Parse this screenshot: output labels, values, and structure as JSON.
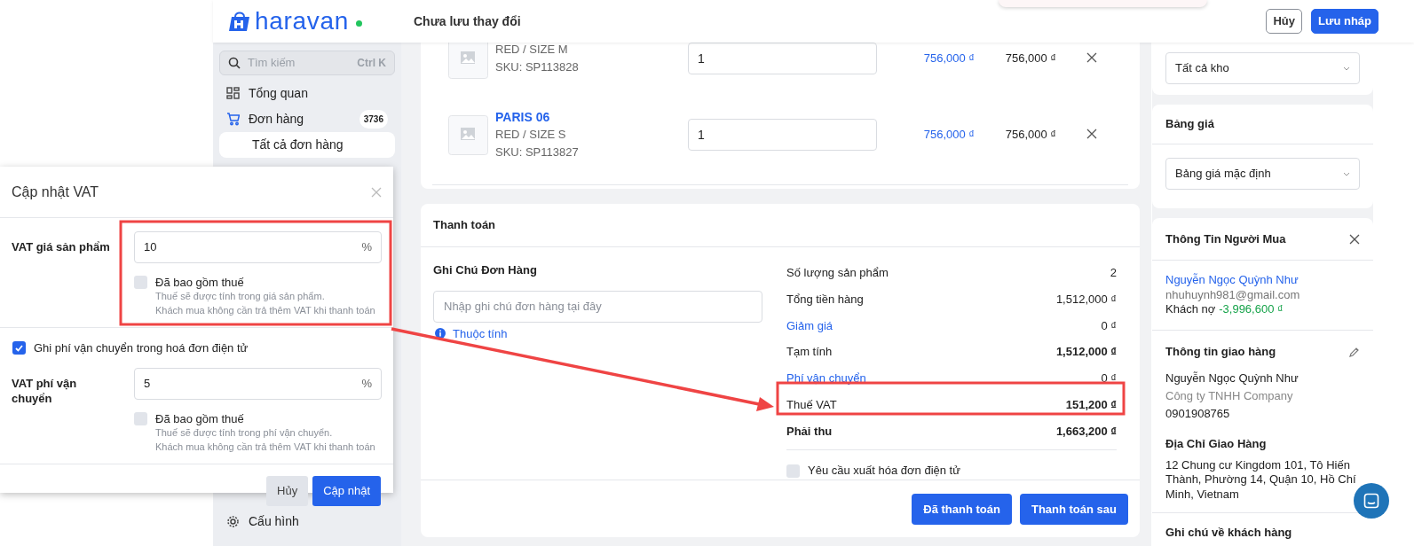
{
  "header": {
    "logo": "haravan",
    "status": "Chưa lưu thay đổi",
    "buttons": [
      {
        "label": "Hủy",
        "kind": "outline"
      },
      {
        "label": "Lưu nháp",
        "kind": "primary"
      }
    ]
  },
  "sidebar": {
    "search": {
      "placeholder": "Tìm kiếm",
      "shortcut": "Ctrl K"
    },
    "items": [
      {
        "label": "Tổng quan",
        "kind": "grid",
        "selected": false
      },
      {
        "label": "Đơn hàng",
        "kind": "cart",
        "badge": "3736",
        "selected": false,
        "children": [
          {
            "label": "Tất cả đơn hàng",
            "selected": true
          }
        ]
      }
    ],
    "bottom_item": {
      "label": "Cấu hình",
      "kind": "gear"
    }
  },
  "products": [
    {
      "variant": "RED / SIZE M",
      "sku": "SKU: SP113828",
      "quantity": "1",
      "price": "756,000 ₫",
      "total": "756,000 ₫"
    },
    {
      "name": "PARIS 06",
      "variant": "RED / SIZE S",
      "sku": "SKU: SP113827",
      "quantity": "1",
      "price": "756,000 ₫",
      "total": "756,000 ₫"
    }
  ],
  "payment": {
    "title": "Thanh toán",
    "note_title": "Ghi Chú Đơn Hàng",
    "note_placeholder": "Nhập ghi chú đơn hàng tại đây",
    "attributes_link": "Thuộc tính",
    "summary": [
      {
        "label": "Số lượng sản phẩm",
        "value": "2",
        "kind": "plain"
      },
      {
        "label": "Tổng tiền hàng",
        "value": "1,512,000 ₫",
        "kind": "plain"
      },
      {
        "label": "Giảm giá",
        "value": "0 ₫",
        "kind": "link"
      },
      {
        "label": "Tạm tính",
        "value": "1,512,000 ₫",
        "kind": "strong_value"
      },
      {
        "label": "Phí vận chuyển",
        "value": "0 ₫",
        "kind": "link"
      },
      {
        "label": "Thuế VAT",
        "value": "151,200 ₫",
        "kind": "strong_value"
      },
      {
        "label": "Phải thu",
        "value": "1,663,200 ₫",
        "kind": "bold"
      }
    ],
    "invoice_request": {
      "label": "Yêu cầu xuất hóa đơn điện tử",
      "checked": false
    },
    "buttons": [
      "Đã thanh toán",
      "Thanh toán sau"
    ]
  },
  "right": {
    "warehouse": "Tất cả kho",
    "price_list": {
      "title": "Bảng giá",
      "value": "Bảng giá mặc định"
    },
    "buyer": {
      "title": "Thông Tin Người Mua",
      "name": "Nguyễn Ngọc Quỳnh Như",
      "email": "nhuhuynh981@gmail.com",
      "debt_label": "Khách nợ",
      "debt": "-3,996,600 ₫"
    },
    "shipping": {
      "title": "Thông tin giao hàng",
      "name": "Nguyễn Ngọc Quỳnh Như",
      "company": "Công ty TNHH Company",
      "phone": "0901908765"
    },
    "address": {
      "title": "Địa Chỉ Giao Hàng",
      "text": "12 Chung cư Kingdom 101, Tô Hiến Thành, Phường 14, Quận 10, Hồ Chí Minh, Vietnam"
    },
    "customer_note_title": "Ghi chú về khách hàng"
  },
  "modal": {
    "title": "Cập nhật VAT",
    "product_vat": {
      "label": "VAT giá sản phẩm",
      "value": "10",
      "unit": "%",
      "included": {
        "label": "Đã bao gồm thuế",
        "checked": false,
        "hints": [
          "Thuế sẽ được tính trong giá sản phẩm.",
          "Khách mua không cần trả thêm VAT khi thanh toán"
        ]
      }
    },
    "shipping_in_invoice": {
      "label": "Ghi phí vận chuyển trong hoá đơn điện tử",
      "checked": true
    },
    "shipping_vat": {
      "label": "VAT phí vận chuyển",
      "value": "5",
      "unit": "%",
      "included": {
        "label": "Đã bao gồm thuế",
        "checked": false,
        "hints": [
          "Thuế sẽ được tính trong phí vận chuyển.",
          "Khách mua không cần trả thêm VAT khi thanh toán"
        ]
      }
    },
    "buttons": [
      {
        "label": "Hủy",
        "kind": "secondary"
      },
      {
        "label": "Cập nhật",
        "kind": "primary"
      }
    ]
  }
}
